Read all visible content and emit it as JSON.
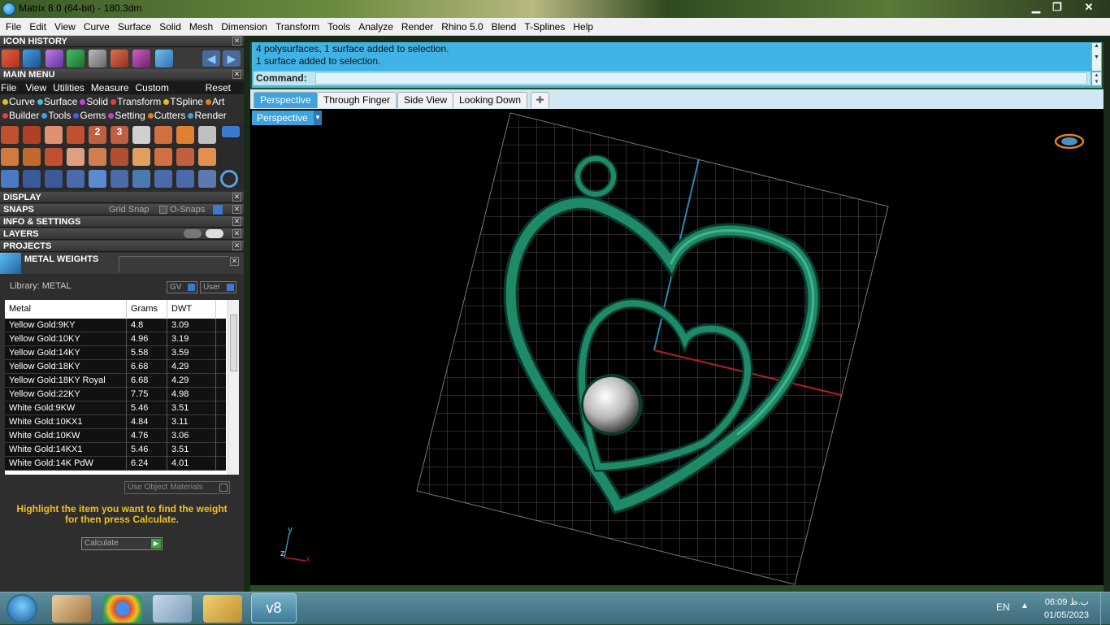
{
  "window": {
    "title": "Matrix 8.0 (64-bit) - 180.3dm",
    "minimize": "▁",
    "restore": "❐",
    "close": "✕"
  },
  "menubar": [
    "File",
    "Edit",
    "View",
    "Curve",
    "Surface",
    "Solid",
    "Mesh",
    "Dimension",
    "Transform",
    "Tools",
    "Analyze",
    "Render",
    "Rhino 5.0",
    "Blend",
    "T-Splines",
    "Help"
  ],
  "panels": {
    "icon_history": "ICON HISTORY",
    "main_menu": "MAIN MENU",
    "main_menu_items": [
      "File",
      "View",
      "Utilities",
      "Measure",
      "Custom"
    ],
    "reset": "Reset",
    "builder_row1": [
      {
        "label": "Curve",
        "color": "#e0c020"
      },
      {
        "label": "Surface",
        "color": "#40c0e0"
      },
      {
        "label": "Solid",
        "color": "#c040e0"
      },
      {
        "label": "Transform",
        "color": "#e04040"
      },
      {
        "label": "TSpline",
        "color": "#e0c020"
      },
      {
        "label": "Art",
        "color": "#e08020"
      }
    ],
    "builder_row2": [
      {
        "label": "Builder",
        "color": "#e04040"
      },
      {
        "label": "Tools",
        "color": "#40a0e0"
      },
      {
        "label": "Gems",
        "color": "#4060e0"
      },
      {
        "label": "Setting",
        "color": "#c040c0"
      },
      {
        "label": "Cutters",
        "color": "#e08020"
      },
      {
        "label": "Render",
        "color": "#40a0e0"
      }
    ],
    "display": "DISPLAY",
    "snaps": "SNAPS",
    "grid_snap": "Grid Snap",
    "o_snaps": "O-Snaps",
    "info_settings": "INFO & SETTINGS",
    "layers": "LAYERS",
    "projects": "PROJECTS",
    "metal_weights": "METAL WEIGHTS"
  },
  "metal": {
    "library_label": "Library: METAL",
    "gv": "GV",
    "user": "User",
    "columns": [
      "Metal",
      "Grams",
      "DWT"
    ],
    "rows": [
      [
        "Yellow Gold:9KY",
        "4.8",
        "3.09"
      ],
      [
        "Yellow Gold:10KY",
        "4.96",
        "3.19"
      ],
      [
        "Yellow Gold:14KY",
        "5.58",
        "3.59"
      ],
      [
        "Yellow Gold:18KY",
        "6.68",
        "4.29"
      ],
      [
        "Yellow Gold:18KY Royal",
        "6.68",
        "4.29"
      ],
      [
        "Yellow Gold:22KY",
        "7.75",
        "4.98"
      ],
      [
        "White Gold:9KW",
        "5.46",
        "3.51"
      ],
      [
        "White Gold:10KX1",
        "4.84",
        "3.11"
      ],
      [
        "White Gold:10KW",
        "4.76",
        "3.06"
      ],
      [
        "White Gold:14KX1",
        "5.46",
        "3.51"
      ],
      [
        "White Gold:14K PdW",
        "6.24",
        "4.01"
      ]
    ],
    "use_object_materials": "Use Object Materials",
    "hint": "Highlight the item you want to find the weight for then press Calculate.",
    "calculate": "Calculate"
  },
  "command": {
    "log": [
      "4 polysurfaces, 1 surface added to selection.",
      "1 surface added to selection."
    ],
    "prompt": "Command:"
  },
  "view_tabs": [
    "Perspective",
    "Through Finger",
    "Side View",
    "Looking Down"
  ],
  "add_tab": "✚",
  "viewport": {
    "label": "Perspective",
    "axis_y": "y",
    "axis_z": "z",
    "axis_x": "x"
  },
  "taskbar": {
    "lang": "EN",
    "time": "06:09 ب.ظ",
    "date": "01/05/2023",
    "app_label": "v8"
  },
  "colors": {
    "accent": "#3fa3de",
    "jewel": "#1e7a60",
    "hint": "#f0c020"
  }
}
